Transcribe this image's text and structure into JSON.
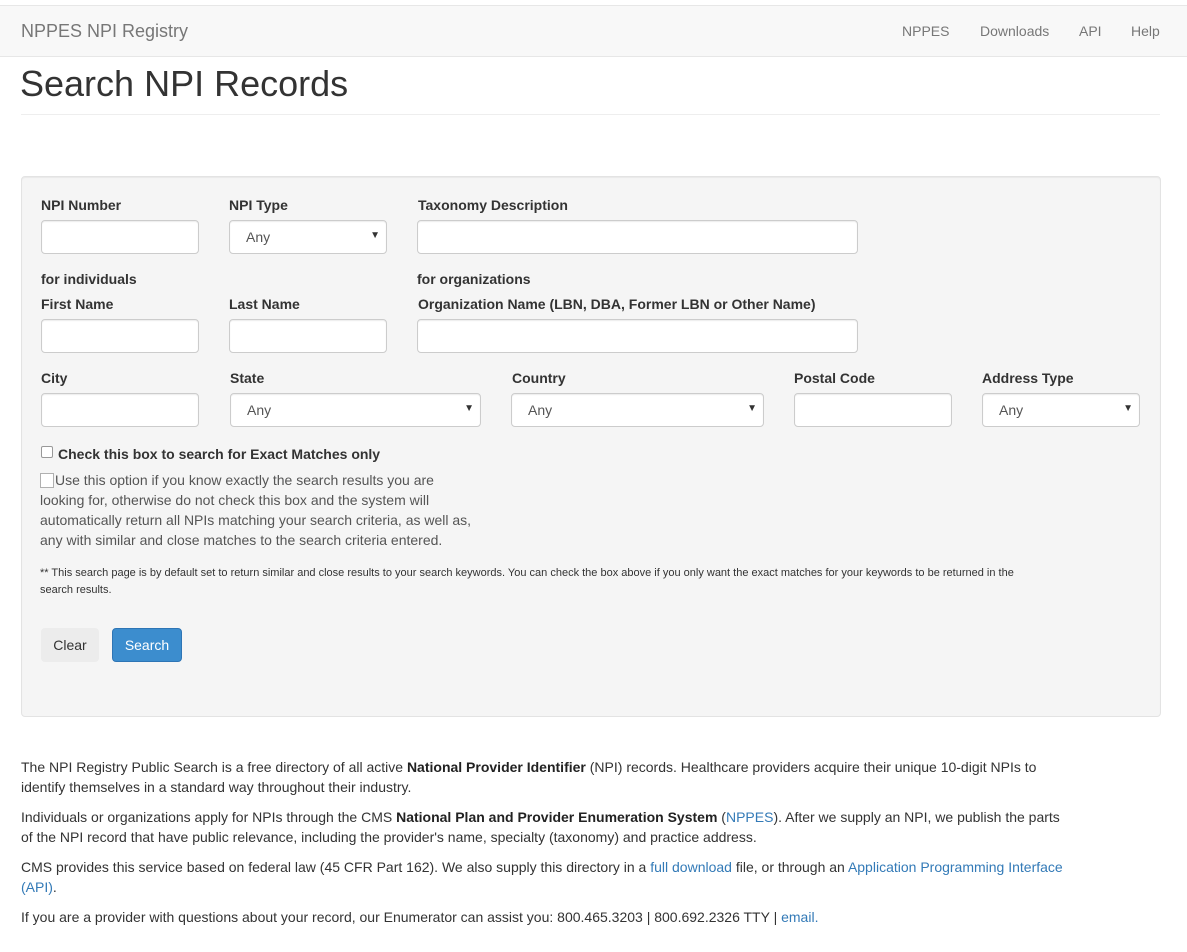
{
  "navbar": {
    "brand": "NPPES NPI Registry",
    "links": [
      "NPPES",
      "Downloads",
      "API",
      "Help"
    ]
  },
  "page_title": "Search NPI Records",
  "form": {
    "npi_number_label": "NPI Number",
    "npi_type_label": "NPI Type",
    "npi_type_value": "Any",
    "taxonomy_label": "Taxonomy Description",
    "individuals_header": "for individuals",
    "organizations_header": "for organizations",
    "first_name_label": "First Name",
    "last_name_label": "Last Name",
    "org_name_label": "Organization Name (LBN, DBA, Former LBN or Other Name)",
    "city_label": "City",
    "state_label": "State",
    "state_value": "Any",
    "country_label": "Country",
    "country_value": "Any",
    "postal_label": "Postal Code",
    "address_type_label": "Address Type",
    "address_type_value": "Any",
    "exact_match_label": "Check this box to search for Exact Matches only",
    "exact_match_help": "Use this option if you know exactly the search results you are looking for, otherwise do not check this box and the system will automatically return all NPIs matching your search criteria, as well as, any with similar and close matches to the search criteria entered.",
    "note": "** This search page is by default set to return similar and close results to your search keywords. You can check the box above if you only want the exact matches for your keywords to be returned in the search results.",
    "clear_button": "Clear",
    "search_button": "Search"
  },
  "info": {
    "p1": {
      "pre": "The NPI Registry Public Search is a free directory of all active ",
      "bold": "National Provider Identifier",
      "post": " (NPI) records. Healthcare providers acquire their unique 10-digit NPIs to identify themselves in a standard way throughout their industry."
    },
    "p2": {
      "pre": "Individuals or organizations apply for NPIs through the CMS ",
      "bold": "National Plan and Provider Enumeration System",
      "mid": " (",
      "link": "NPPES",
      "post": "). After we supply an NPI, we publish the parts of the NPI record that have public relevance, including the provider's name, specialty (taxonomy) and practice address."
    },
    "p3": {
      "pre": "CMS provides this service based on federal law (45 CFR Part 162). We also supply this directory in a ",
      "link1": "full download",
      "mid": " file, or through an ",
      "link2": "Application Programming Interface (API)",
      "post": "."
    },
    "p4": {
      "pre": "If you are a provider with questions about your record, our Enumerator can assist you: 800.465.3203 | 800.692.2326 TTY | ",
      "link": "email."
    }
  },
  "colors": {
    "link": "#337ab7",
    "primary_button": "#3c8dce",
    "panel_bg": "#f5f5f5",
    "navbar_bg": "#f8f8f8"
  }
}
